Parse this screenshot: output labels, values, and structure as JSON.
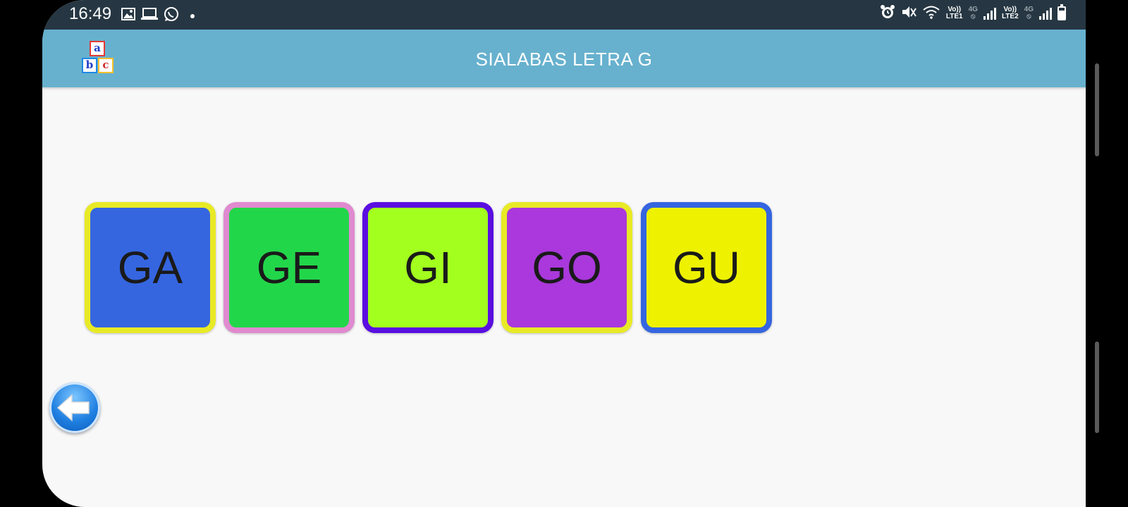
{
  "status_bar": {
    "time": "16:49",
    "left_icons": [
      "image-icon",
      "laptop-icon",
      "whatsapp-icon"
    ],
    "sim1_label_top": "Vo))",
    "sim1_label_bottom": "LTE1",
    "sim1_network": "4G",
    "sim2_label_top": "Vo))",
    "sim2_label_bottom": "LTE2",
    "sim2_network": "4G"
  },
  "app_bar": {
    "title": "SIALABAS LETRA G",
    "logo_letters": [
      "a",
      "b",
      "c"
    ]
  },
  "syllables": [
    {
      "label": "GA",
      "fill": "#3566e0",
      "border": "#e8ea26"
    },
    {
      "label": "GE",
      "fill": "#22d64a",
      "border": "#e08ad0"
    },
    {
      "label": "GI",
      "fill": "#a2ff1e",
      "border": "#5a0fe0"
    },
    {
      "label": "GO",
      "fill": "#aa38dc",
      "border": "#e8ea26"
    },
    {
      "label": "GU",
      "fill": "#eef200",
      "border": "#3566e0"
    }
  ],
  "colors": {
    "status_bar_bg": "#263743",
    "app_bar_bg": "#67b1ce",
    "content_bg": "#f8f8f9"
  }
}
